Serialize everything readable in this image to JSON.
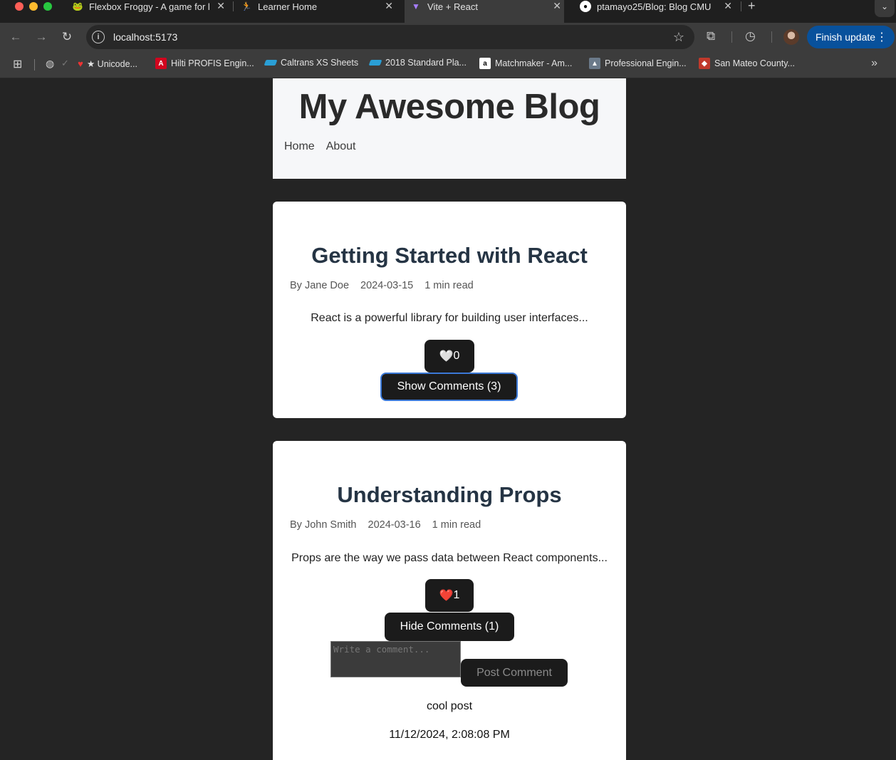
{
  "browser": {
    "tabs": [
      {
        "title": "Flexbox Froggy - A game for l",
        "icon": "frog-icon"
      },
      {
        "title": "Learner Home",
        "icon": "runner-icon"
      },
      {
        "title": "Vite + React",
        "icon": "vite-icon"
      },
      {
        "title": "ptamayo25/Blog: Blog CMU",
        "icon": "github-icon"
      }
    ],
    "new_tab": "+",
    "url": "localhost:5173",
    "update_button": "Finish update",
    "bookmarks": [
      {
        "label": "★ Unicode...",
        "icon": "heart-icon"
      },
      {
        "label": "Hilti PROFIS Engin...",
        "icon": "hilti-icon"
      },
      {
        "label": "Caltrans XS Sheets",
        "icon": "caltrans-icon"
      },
      {
        "label": "2018 Standard Pla...",
        "icon": "caltrans-icon"
      },
      {
        "label": "Matchmaker - Am...",
        "icon": "amazon-icon"
      },
      {
        "label": "Professional Engin...",
        "icon": "engineer-icon"
      },
      {
        "label": "San Mateo County...",
        "icon": "county-icon"
      }
    ]
  },
  "site": {
    "title": "My Awesome Blog",
    "nav": [
      "Home",
      "About"
    ]
  },
  "posts": [
    {
      "title": "Getting Started with React",
      "author": "By Jane Doe",
      "date": "2024-03-15",
      "read_time": "1 min read",
      "excerpt": "React is a powerful library for building user interfaces...",
      "like_icon": "🤍",
      "likes": "0",
      "comments_button": "Show Comments (3)"
    },
    {
      "title": "Understanding Props",
      "author": "By John Smith",
      "date": "2024-03-16",
      "read_time": "1 min read",
      "excerpt": "Props are the way we pass data between React components...",
      "like_icon": "❤️",
      "likes": "1",
      "comments_button": "Hide Comments (1)",
      "comment_placeholder": "Write a comment...",
      "post_button": "Post Comment",
      "comments": [
        {
          "text": "cool post",
          "timestamp": "11/12/2024, 2:08:08 PM"
        }
      ]
    }
  ]
}
